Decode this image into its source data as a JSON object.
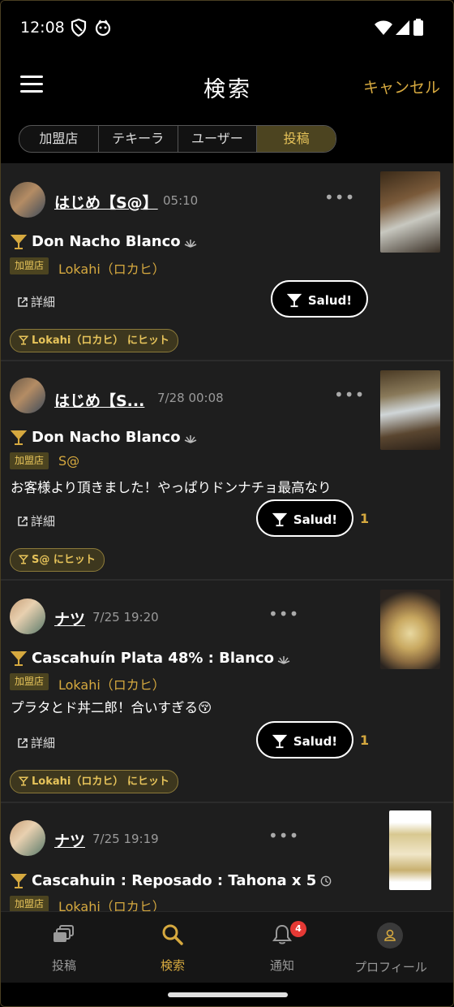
{
  "status_bar": {
    "time": "12:08"
  },
  "header": {
    "title": "検索",
    "cancel_label": "キャンセル"
  },
  "tabs": [
    {
      "label": "加盟店",
      "active": false
    },
    {
      "label": "テキーラ",
      "active": false
    },
    {
      "label": "ユーザー",
      "active": false
    },
    {
      "label": "投稿",
      "active": true
    }
  ],
  "posts": [
    {
      "user": "はじめ【S@】",
      "time": "05:10",
      "drink": "Don Nacho Blanco",
      "badge": "加盟店",
      "shop": "Lokahi（ロカヒ）",
      "comment": "",
      "detail_label": "詳細",
      "salud_label": "Salud!",
      "salud_count": "",
      "hit_label": "Lokahi（ロカヒ） にヒット"
    },
    {
      "user": "はじめ【S...",
      "time": "7/28 00:08",
      "drink": "Don Nacho Blanco",
      "badge": "加盟店",
      "shop": "S@",
      "comment": "お客様より頂きました！やっぱりドンナチョ最高なり",
      "detail_label": "詳細",
      "salud_label": "Salud!",
      "salud_count": "1",
      "hit_label": "S@ にヒット"
    },
    {
      "user": "ナツ",
      "time": "7/25 19:20",
      "drink": "Cascahuín Plata 48% : Blanco",
      "badge": "加盟店",
      "shop": "Lokahi（ロカヒ）",
      "comment": "プラタとド丼二郎！合いすぎる😚",
      "detail_label": "詳細",
      "salud_label": "Salud!",
      "salud_count": "1",
      "hit_label": "Lokahi（ロカヒ） にヒット"
    },
    {
      "user": "ナツ",
      "time": "7/25 19:19",
      "drink": "Cascahuin : Reposado : Tahona x 5",
      "badge": "加盟店",
      "shop": "Lokahi（ロカヒ）"
    }
  ],
  "bottom_nav": [
    {
      "label": "投稿",
      "icon": "posts-icon",
      "active": false
    },
    {
      "label": "検索",
      "icon": "search-icon",
      "active": true
    },
    {
      "label": "通知",
      "icon": "bell-icon",
      "active": false,
      "badge": "4"
    },
    {
      "label": "プロフィール",
      "icon": "profile-icon",
      "active": false
    }
  ],
  "colors": {
    "accent": "#d6a93f",
    "badge_bg": "#4c4420",
    "feed_bg": "#1e1e1e"
  }
}
